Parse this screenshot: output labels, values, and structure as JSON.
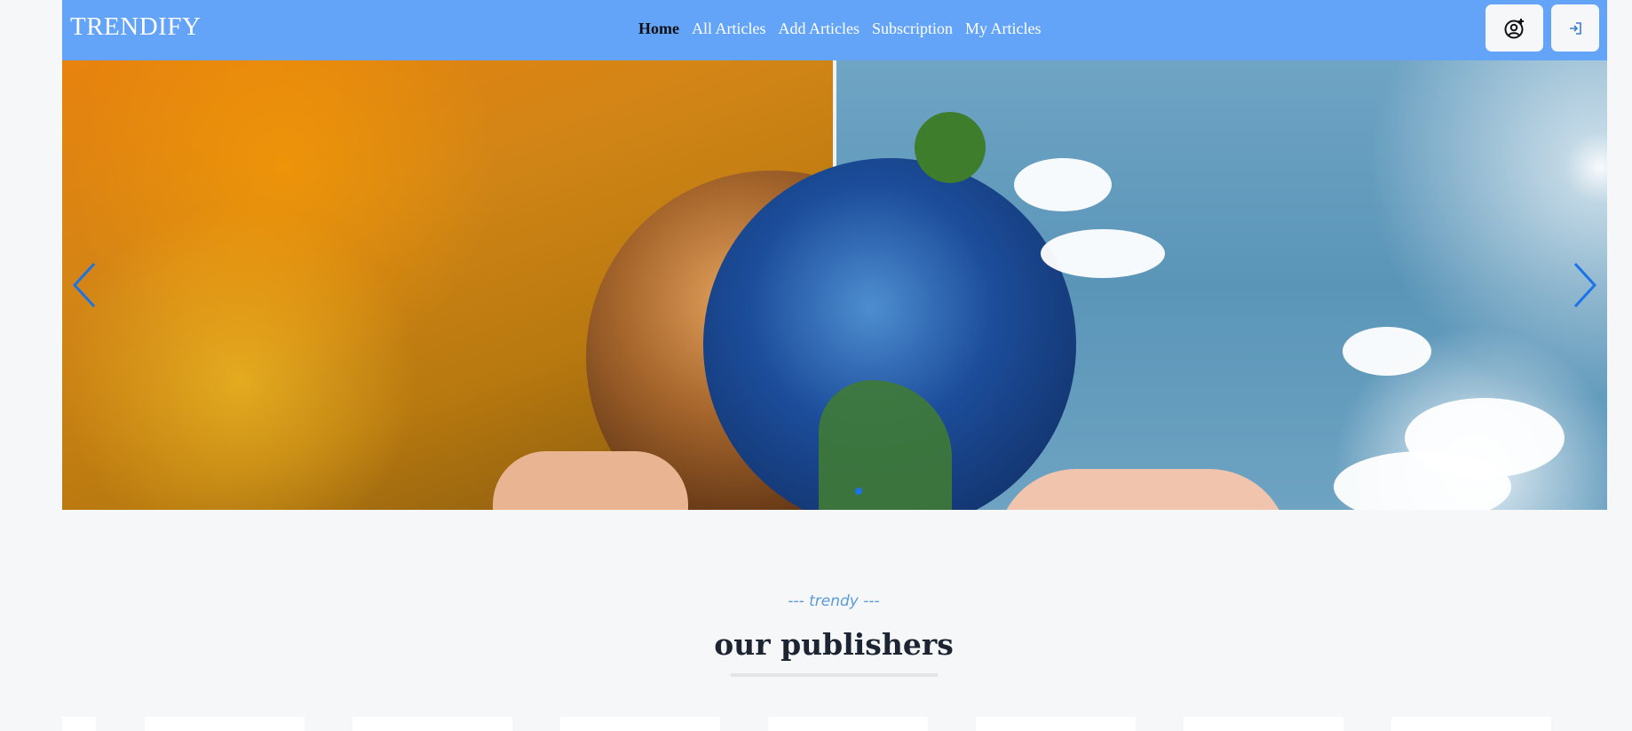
{
  "brand": "TRENDIFY",
  "nav": {
    "items": [
      {
        "label": "Home",
        "active": true
      },
      {
        "label": "All Articles",
        "active": false
      },
      {
        "label": "Add Articles",
        "active": false
      },
      {
        "label": "Subscription",
        "active": false
      },
      {
        "label": "My Articles",
        "active": false
      }
    ]
  },
  "header_buttons": {
    "user_icon": "user-plus-icon",
    "login_icon": "login-icon"
  },
  "hero": {
    "prev_icon": "chevron-left-icon",
    "next_icon": "chevron-right-icon",
    "slides_count": 1,
    "active_slide": 1
  },
  "section": {
    "tag": "--- trendy ---",
    "title": "our publishers"
  },
  "colors": {
    "navbar_bg": "#63a4f8",
    "page_bg": "#f6f7f9",
    "accent": "#1a73e8",
    "tag": "#5a9bd8",
    "title": "#1d2533"
  }
}
